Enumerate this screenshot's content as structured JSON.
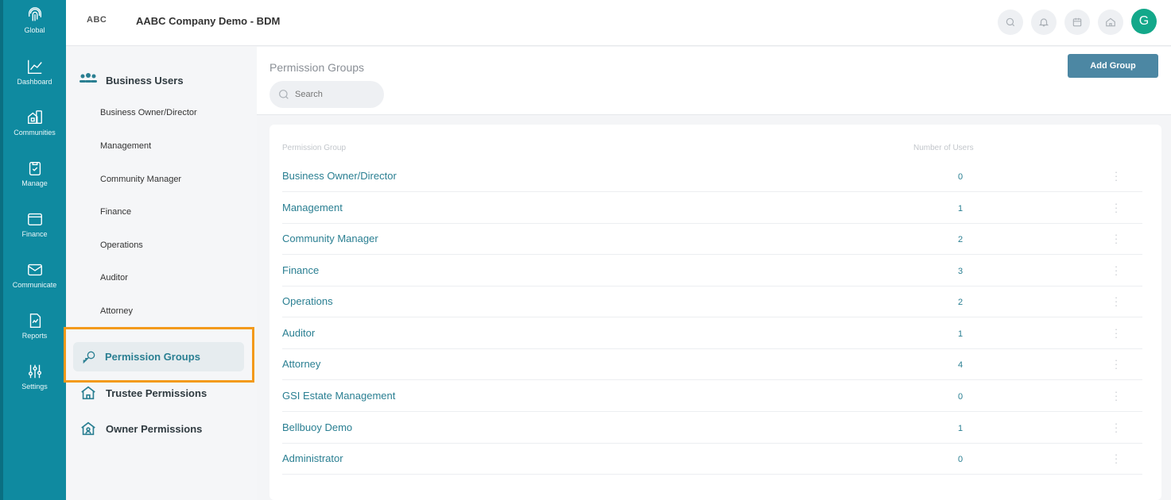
{
  "rail": {
    "items": [
      {
        "label": "Global",
        "icon": "fingerprint-icon"
      },
      {
        "label": "Dashboard",
        "icon": "line-chart-icon"
      },
      {
        "label": "Communities",
        "icon": "buildings-icon"
      },
      {
        "label": "Manage",
        "icon": "clipboard-check-icon"
      },
      {
        "label": "Finance",
        "icon": "wallet-icon"
      },
      {
        "label": "Communicate",
        "icon": "envelope-icon"
      },
      {
        "label": "Reports",
        "icon": "report-icon"
      },
      {
        "label": "Settings",
        "icon": "sliders-icon"
      }
    ]
  },
  "header": {
    "logo": "ABC",
    "company": "AABC Company Demo - BDM",
    "avatar_initial": "G"
  },
  "sidebar": {
    "business_users": "Business Users",
    "items": [
      "Business Owner/Director",
      "Management",
      "Community Manager",
      "Finance",
      "Operations",
      "Auditor",
      "Attorney"
    ],
    "permission_groups": "Permission Groups",
    "trustee_permissions": "Trustee Permissions",
    "owner_permissions": "Owner Permissions"
  },
  "main": {
    "title": "Permission Groups",
    "search_placeholder": "Search",
    "add_group": "Add Group",
    "col_group": "Permission Group",
    "col_users": "Number of Users",
    "rows": [
      {
        "name": "Business Owner/Director",
        "count": "0"
      },
      {
        "name": "Management",
        "count": "1"
      },
      {
        "name": "Community Manager",
        "count": "2"
      },
      {
        "name": "Finance",
        "count": "3"
      },
      {
        "name": "Operations",
        "count": "2"
      },
      {
        "name": "Auditor",
        "count": "1"
      },
      {
        "name": "Attorney",
        "count": "4"
      },
      {
        "name": "GSI Estate Management",
        "count": "0"
      },
      {
        "name": "Bellbuoy Demo",
        "count": "1"
      },
      {
        "name": "Administrator",
        "count": "0"
      }
    ]
  },
  "colors": {
    "rail": "#0f8aa0",
    "accent": "#2a7f92",
    "button": "#4c87a3",
    "highlight": "#f39a1b",
    "avatar": "#13a88a"
  }
}
